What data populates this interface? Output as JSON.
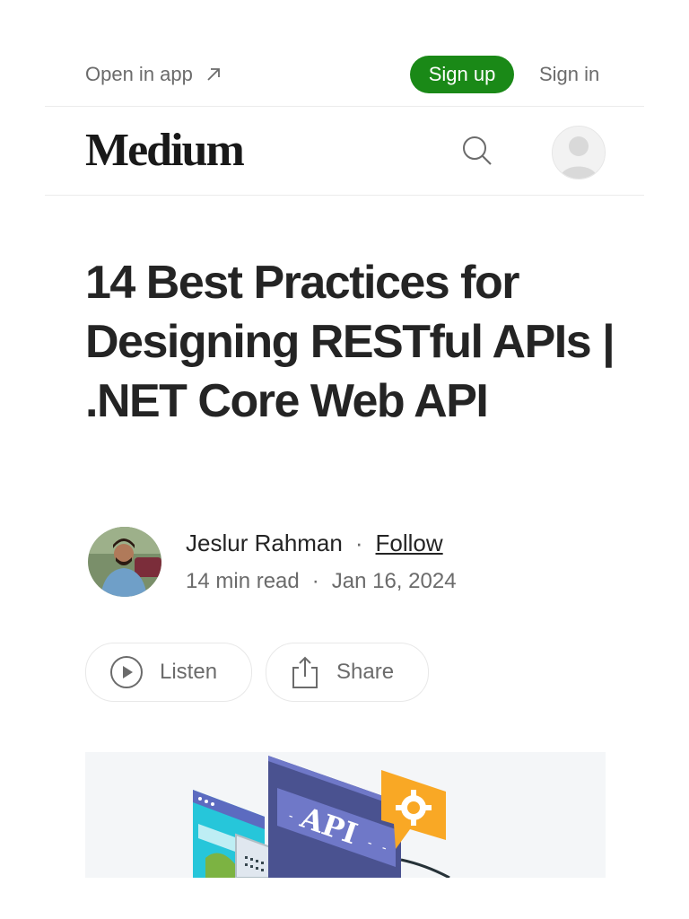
{
  "topbar": {
    "open_in_app": "Open in app",
    "open_in_app_icon": "arrow-up-right-icon",
    "sign_up": "Sign up",
    "sign_in": "Sign in",
    "sign_up_color": "#1a8917"
  },
  "header": {
    "logo": "Medium",
    "search_icon": "search-icon",
    "avatar_icon": "user-avatar-icon"
  },
  "article": {
    "title": "14 Best Practices for Designing RESTful APIs | .NET Core Web API",
    "author": {
      "name": "Jeslur Rahman",
      "separator": "·",
      "follow": "Follow"
    },
    "meta": {
      "read_time": "14 min read",
      "separator": "·",
      "date": "Jan 16, 2024"
    },
    "actions": {
      "listen": "Listen",
      "listen_icon": "play-circle-icon",
      "share": "Share",
      "share_icon": "share-icon"
    },
    "hero": {
      "api_label": "API",
      "accent_colors": [
        "#5c6bc0",
        "#f9a825",
        "#26c6da",
        "#7cb342"
      ]
    }
  }
}
